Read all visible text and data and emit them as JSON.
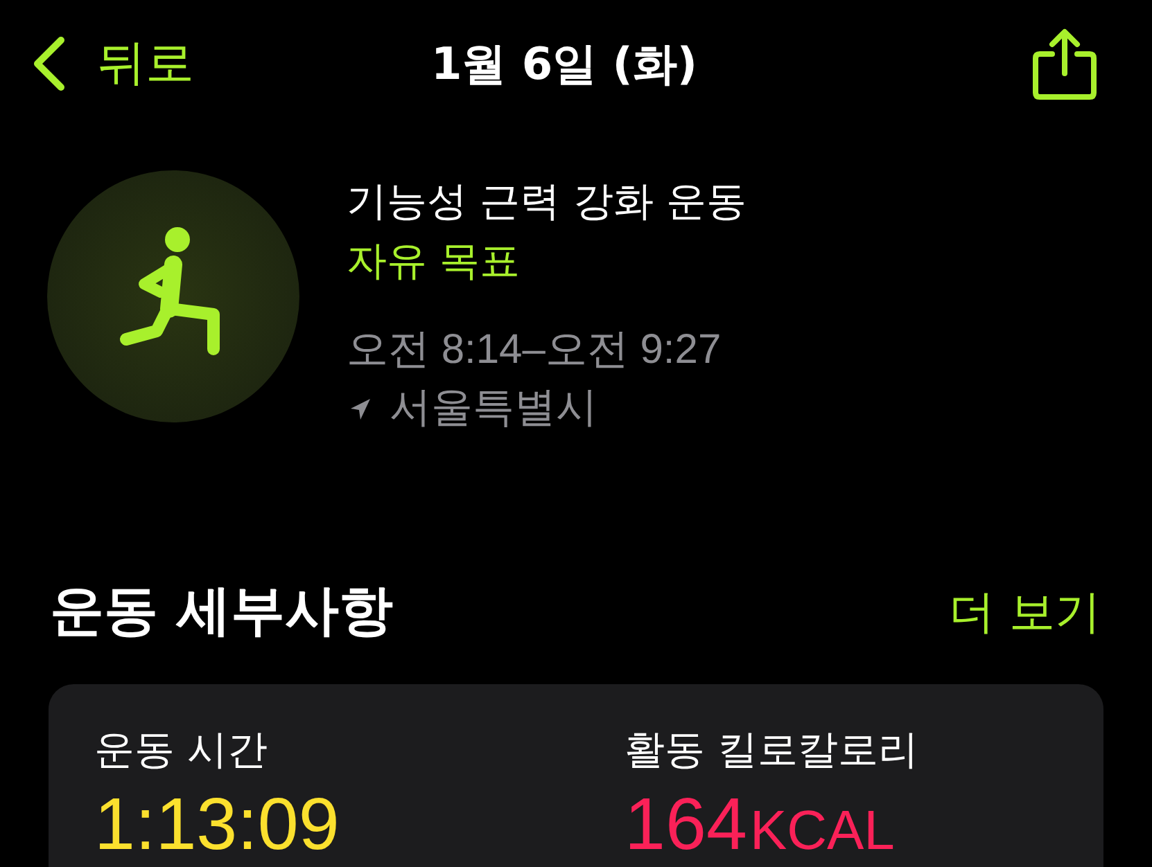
{
  "nav": {
    "back_label": "뒤로",
    "title": "1월 6일 (화)"
  },
  "workout": {
    "name": "기능성 근력 강화 운동",
    "goal": "자유 목표",
    "time_range": "오전 8:14–오전 9:27",
    "location": "서울특별시"
  },
  "details": {
    "heading": "운동 세부사항",
    "more_link": "더 보기",
    "metrics": [
      {
        "label": "운동 시간",
        "value": "1:13:09",
        "color": "#fbe02e"
      },
      {
        "label": "활동 킬로칼로리",
        "value": "164",
        "unit": "KCAL",
        "color": "#fa2158"
      }
    ]
  }
}
